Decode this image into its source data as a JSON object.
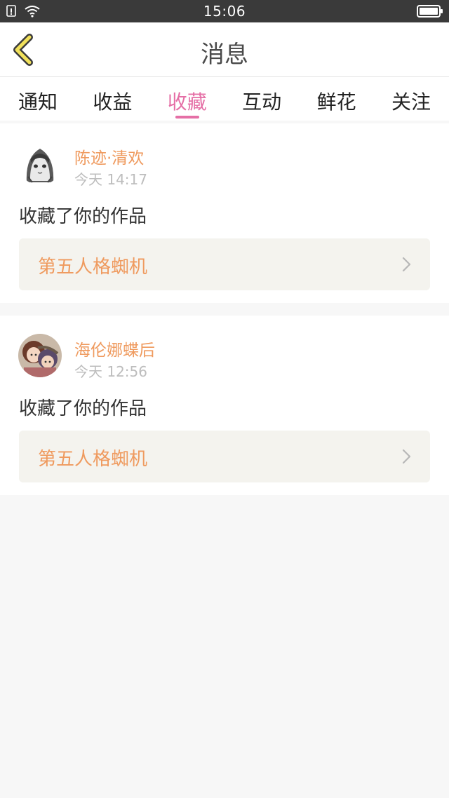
{
  "status_bar": {
    "time": "15:06"
  },
  "header": {
    "title": "消息"
  },
  "tabs": [
    {
      "label": "通知",
      "active": false
    },
    {
      "label": "收益",
      "active": false
    },
    {
      "label": "收藏",
      "active": true
    },
    {
      "label": "互动",
      "active": false
    },
    {
      "label": "鲜花",
      "active": false
    },
    {
      "label": "关注",
      "active": false
    }
  ],
  "messages": [
    {
      "username": "陈迹·清欢",
      "time": "今天 14:17",
      "action": "收藏了你的作品",
      "work_title": "第五人格蜘机"
    },
    {
      "username": "海伦娜蝶后",
      "time": "今天 12:56",
      "action": "收藏了你的作品",
      "work_title": "第五人格蜘机"
    }
  ],
  "colors": {
    "accent": "#e56fa6",
    "name": "#ef9a5e",
    "back_icon": "#f1e15b"
  },
  "icons": [
    "back-chevron-icon",
    "chevron-right-icon",
    "wifi-icon",
    "battery-icon",
    "sim-alert-icon"
  ]
}
